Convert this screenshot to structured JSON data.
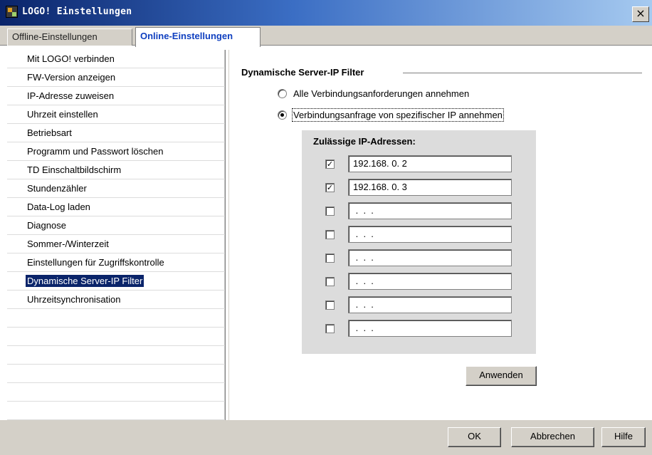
{
  "window": {
    "title": "LOGO! Einstellungen",
    "close_glyph": "×",
    "logo_icon": "logo-app-icon"
  },
  "tabs": [
    {
      "label": "Offline-Einstellungen",
      "active": false
    },
    {
      "label": "Online-Einstellungen",
      "active": true
    }
  ],
  "sidebar": {
    "items": [
      {
        "label": "Mit LOGO! verbinden"
      },
      {
        "label": "FW-Version anzeigen"
      },
      {
        "label": "IP-Adresse zuweisen"
      },
      {
        "label": "Uhrzeit einstellen"
      },
      {
        "label": "Betriebsart"
      },
      {
        "label": "Programm und Passwort löschen"
      },
      {
        "label": "TD Einschaltbildschirm"
      },
      {
        "label": "Stundenzähler"
      },
      {
        "label": "Data-Log laden"
      },
      {
        "label": "Diagnose"
      },
      {
        "label": "Sommer-/Winterzeit"
      },
      {
        "label": "Einstellungen für Zugriffskontrolle"
      },
      {
        "label": "Dynamische Server-IP Filter",
        "selected": true
      },
      {
        "label": "Uhrzeitsynchronisation"
      }
    ]
  },
  "main": {
    "section_title": "Dynamische Server-IP Filter",
    "radio_all": {
      "label": "Alle Verbindungsanforderungen annehmen",
      "checked": false
    },
    "radio_specific": {
      "label": "Verbindungsanfrage von spezifischer IP annehmen",
      "checked": true
    },
    "ip_panel": {
      "title": "Zulässige IP-Adressen:",
      "rows": [
        {
          "checked": true,
          "check_glyph": "✓",
          "value": "192.168. 0. 2"
        },
        {
          "checked": true,
          "check_glyph": "✓",
          "value": "192.168. 0. 3"
        },
        {
          "checked": false,
          "check_glyph": "",
          "value": " .  .  ."
        },
        {
          "checked": false,
          "check_glyph": "",
          "value": " .  .  ."
        },
        {
          "checked": false,
          "check_glyph": "",
          "value": " .  .  ."
        },
        {
          "checked": false,
          "check_glyph": "",
          "value": " .  .  ."
        },
        {
          "checked": false,
          "check_glyph": "",
          "value": " .  .  ."
        },
        {
          "checked": false,
          "check_glyph": "",
          "value": " .  .  ."
        }
      ]
    },
    "apply_label": "Anwenden"
  },
  "footer": {
    "ok_label": "OK",
    "cancel_label": "Abbrechen",
    "help_label": "Hilfe"
  },
  "colors": {
    "titlebar": "#0a246a",
    "selection": "#0a246a",
    "active_tab_text": "#1040c0",
    "dialog_bg": "#d4d0c8"
  }
}
